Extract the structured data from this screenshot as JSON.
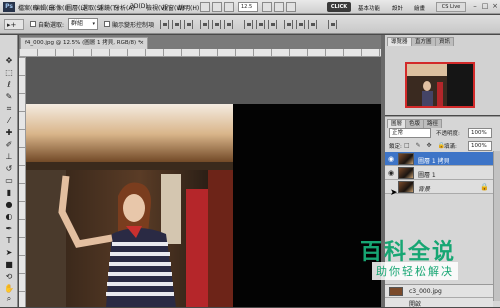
{
  "app": {
    "logo": "Ps"
  },
  "menu": [
    "檔案(F)",
    "編輯(E)",
    "影像(I)",
    "圖層(L)",
    "選取(S)",
    "濾鏡(T)",
    "分析(A)",
    "3D(D)",
    "檢視(V)",
    "視窗(W)",
    "說明(H)"
  ],
  "top": {
    "zoom": "12.5",
    "clicks": "CLICK",
    "workspace_basic": "基本功能",
    "workspace_design": "設計",
    "workspace_paint": "繪畫",
    "cs_live": "CS Live"
  },
  "options": {
    "tool_glyph": "▸+",
    "auto_select_label": "自動選取:",
    "auto_select_value": "群組",
    "transform_label": "顯示變形控制項"
  },
  "document": {
    "tab_title": "f4_000.jpg @ 12.5% (圖層 1 拷貝, RGB/8) *",
    "close": "×"
  },
  "panels": {
    "navigator_tabs": [
      "導覽器",
      "直方圖",
      "資訊"
    ],
    "layers_tabs": [
      "圖層",
      "色版",
      "路徑"
    ],
    "blend_mode": "正常",
    "opacity_label": "不透明度:",
    "opacity_value": "100%",
    "lock_label": "鎖定:",
    "lock_icons": "□ ✎ ✥ 🔒",
    "fill_label": "填滿:",
    "fill_value": "100%",
    "layers": [
      {
        "name": "圖層 1 拷貝",
        "selected": true,
        "locked": false
      },
      {
        "name": "圖層 1",
        "selected": false,
        "locked": false
      },
      {
        "name": "背景",
        "selected": false,
        "locked": true
      }
    ],
    "bottom_rows": [
      "c3_000.jpg",
      "開啟"
    ]
  },
  "watermark": {
    "title": "百科全说",
    "subtitle": "助你轻松解决"
  },
  "icons": {
    "tools": [
      "move-icon",
      "marquee-icon",
      "lasso-icon",
      "quick-select-icon",
      "crop-icon",
      "eyedropper-icon",
      "healing-brush-icon",
      "brush-icon",
      "clone-stamp-icon",
      "history-brush-icon",
      "eraser-icon",
      "gradient-icon",
      "blur-icon",
      "dodge-icon",
      "pen-icon",
      "type-icon",
      "path-select-icon",
      "shape-icon",
      "3d-rotate-icon",
      "hand-icon",
      "zoom-icon"
    ]
  },
  "colors": {
    "accent": "#3d74c7",
    "watermark": "#17a673",
    "nav_frame": "#d22a2a"
  }
}
